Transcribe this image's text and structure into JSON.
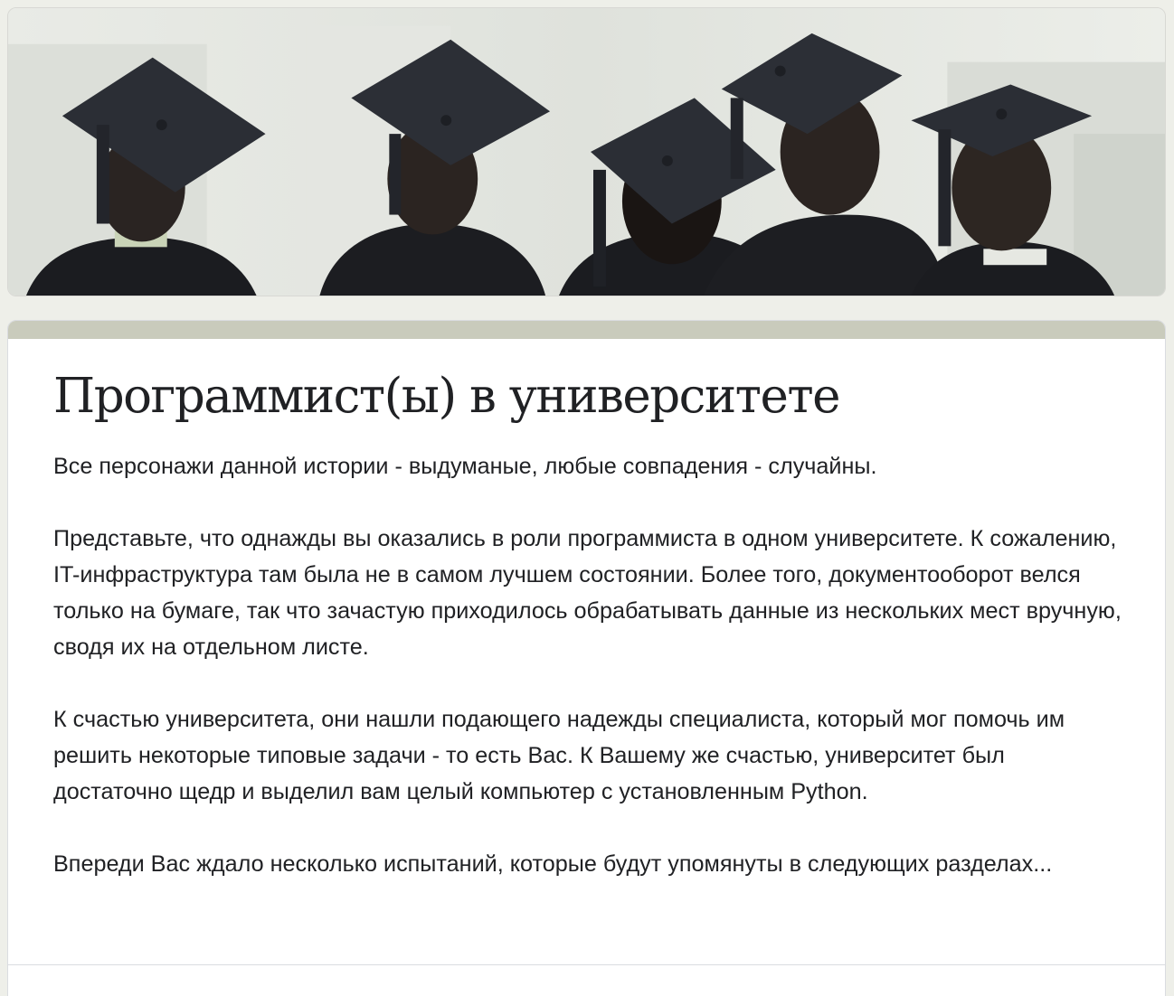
{
  "form": {
    "title": "Программист(ы) в университете",
    "description": [
      "Все персонажи данной истории - выдуманые, любые совпадения - случайны.",
      "Представьте, что однажды вы оказались в роли программиста в одном университете. К сожалению, IT-инфраструктура там была не в самом лучшем состоянии. Более того, документооборот велся только на бумаге, так что зачастую приходилось обрабатывать данные из нескольких мест вручную, сводя их на отдельном листе.",
      "К счастью университета, они нашли подающего надежды специалиста, который мог помочь им решить некоторые типовые задачи - то есть Вас. К Вашему же счастью, университет был достаточно щедр и выделил вам целый компьютер с установленным Python.",
      "Впереди Вас ждало несколько испытаний, которые будут упомянуты в следующих разделах..."
    ]
  },
  "colors": {
    "background": "#eeefe9",
    "accent": "#c9cbbc",
    "card": "#ffffff",
    "text": "#202124"
  }
}
